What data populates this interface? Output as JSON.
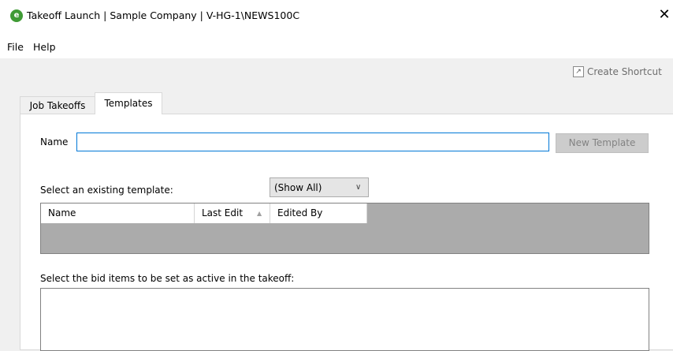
{
  "window": {
    "title": "Takeoff Launch | Sample Company | V-HG-1\\NEWS100C",
    "app_icon_glyph": "e",
    "app_icon_color": "#3f9b35",
    "close_glyph": "✕"
  },
  "menu": {
    "items": [
      {
        "label": "File"
      },
      {
        "label": "Help"
      }
    ]
  },
  "shortcut": {
    "label": "Create Shortcut",
    "icon": "shortcut-arrow-icon"
  },
  "tabs": [
    {
      "label": "Job Takeoffs",
      "active": false
    },
    {
      "label": "Templates",
      "active": true
    }
  ],
  "templates_panel": {
    "name_label": "Name",
    "name_value": "",
    "new_template_label": "New Template",
    "select_existing_label": "Select an existing template:",
    "filter_selected": "(Show All)",
    "grid_columns": [
      {
        "label": "Name"
      },
      {
        "label": "Last Edit",
        "sorted": "ascending"
      },
      {
        "label": "Edited By"
      }
    ],
    "grid_rows": [],
    "bid_items_label": "Select the bid items to be set as active in the takeoff:",
    "bid_items": []
  },
  "colors": {
    "accent_border": "#0078d7",
    "grid_background": "#ababab",
    "disabled_button": "#cccccc"
  }
}
